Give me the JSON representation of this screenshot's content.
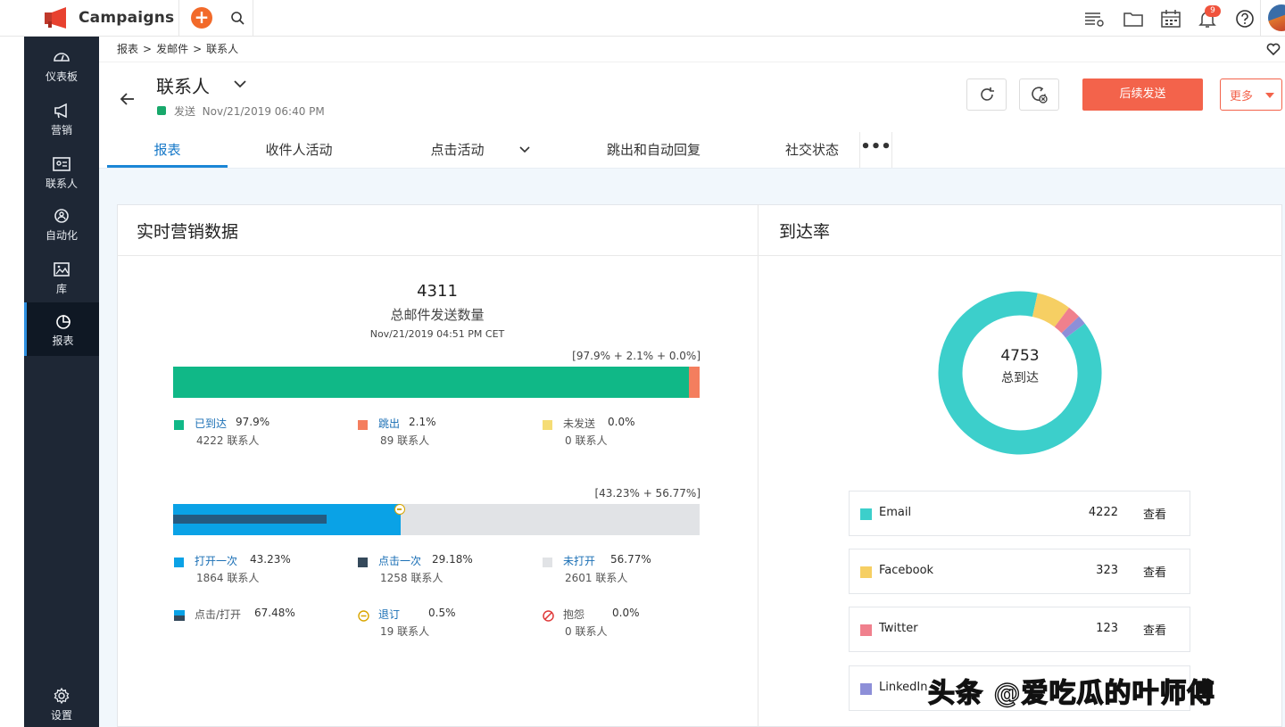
{
  "app": {
    "brand": "Campaigns",
    "add_symbol": "+",
    "notification_count": "9",
    "brand_color": "#f26a2a"
  },
  "topbar_icons": [
    "search-icon",
    "filter-list-icon",
    "folder-icon",
    "calendar-icon",
    "bell-icon",
    "help-icon"
  ],
  "sidebar": {
    "items": [
      {
        "label": "仪表板",
        "icon": "dashboard-icon"
      },
      {
        "label": "营销",
        "icon": "megaphone-icon"
      },
      {
        "label": "联系人",
        "icon": "contact-card-icon"
      },
      {
        "label": "自动化",
        "icon": "automation-icon"
      },
      {
        "label": "库",
        "icon": "image-library-icon"
      },
      {
        "label": "报表",
        "icon": "pie-chart-icon",
        "active": true
      },
      {
        "label": "设置",
        "icon": "gear-icon"
      }
    ]
  },
  "breadcrumb": {
    "level1": "报表",
    "level2": "发邮件",
    "level3": "联系人",
    "separator": ">"
  },
  "header": {
    "title": "联系人",
    "status": "发送",
    "date": "Nov/21/2019 06:40 PM",
    "followup_label": "后续发送",
    "more_label": "更多"
  },
  "tabs": [
    {
      "label": "报表",
      "active": true
    },
    {
      "label": "收件人活动"
    },
    {
      "label": "点击活动"
    },
    {
      "label": "跳出和自动回复"
    },
    {
      "label": "社交状态"
    }
  ],
  "tab_more": "•••",
  "realtime": {
    "title": "实时营销数据",
    "total": "4311",
    "total_label": "总邮件发送数量",
    "total_date": "Nov/21/2019 04:51 PM CET",
    "delivery_note": "[97.9% + 2.1% + 0.0%]",
    "open_note": "[43.23% + 56.77%]",
    "delivery_bar": [
      {
        "name": "已到达",
        "percent": 97.9,
        "color": "#10b887"
      },
      {
        "name": "跳出",
        "percent": 2.1,
        "color": "#f47e5e"
      },
      {
        "name": "未发送",
        "percent": 0.0,
        "color": "#f5dc75"
      }
    ],
    "open_bar": {
      "opened_percent": 43.23,
      "clicked_percent": 29.18,
      "unopened_percent": 56.77,
      "open_color": "#0aa2e6",
      "click_color": "#255a80",
      "unopened_color": "#e1e3e6"
    },
    "delivery_legend": [
      {
        "name": "已到达",
        "pct": "97.9%",
        "count": "4222 联系人",
        "color": "#10b887"
      },
      {
        "name": "跳出",
        "pct": "2.1%",
        "count": "89 联系人",
        "color": "#f47e5e"
      },
      {
        "name": "未发送",
        "pct": "0.0%",
        "count": "0 联系人",
        "color": "#f5dc75"
      }
    ],
    "open_legend": [
      {
        "name": "打开一次",
        "pct": "43.23%",
        "count": "1864 联系人",
        "color": "#0aa2e6"
      },
      {
        "name": "点击一次",
        "pct": "29.18%",
        "count": "1258 联系人",
        "color": "#35495b"
      },
      {
        "name": "未打开",
        "pct": "56.77%",
        "count": "2601 联系人",
        "color": "#e1e3e6"
      }
    ],
    "other_legend": [
      {
        "name": "点击/打开",
        "pct": "67.48%",
        "count": ""
      },
      {
        "name": "退订",
        "pct": "0.5%",
        "count": "19 联系人"
      },
      {
        "name": "抱怨",
        "pct": "0.0%",
        "count": "0 联系人"
      }
    ]
  },
  "reach": {
    "title": "到达率",
    "total": "4753",
    "total_label": "总到达",
    "view_label": "查看",
    "sources": [
      {
        "name": "Email",
        "count": 4222,
        "color": "#3ccfcb"
      },
      {
        "name": "Facebook",
        "count": 323,
        "color": "#f6cf63"
      },
      {
        "name": "Twitter",
        "count": 123,
        "color": "#f0808d"
      },
      {
        "name": "LinkedIn",
        "count": 85,
        "color": "#8d8fd8"
      }
    ]
  },
  "watermark": "头条 @爱吃瓜的叶师傅"
}
